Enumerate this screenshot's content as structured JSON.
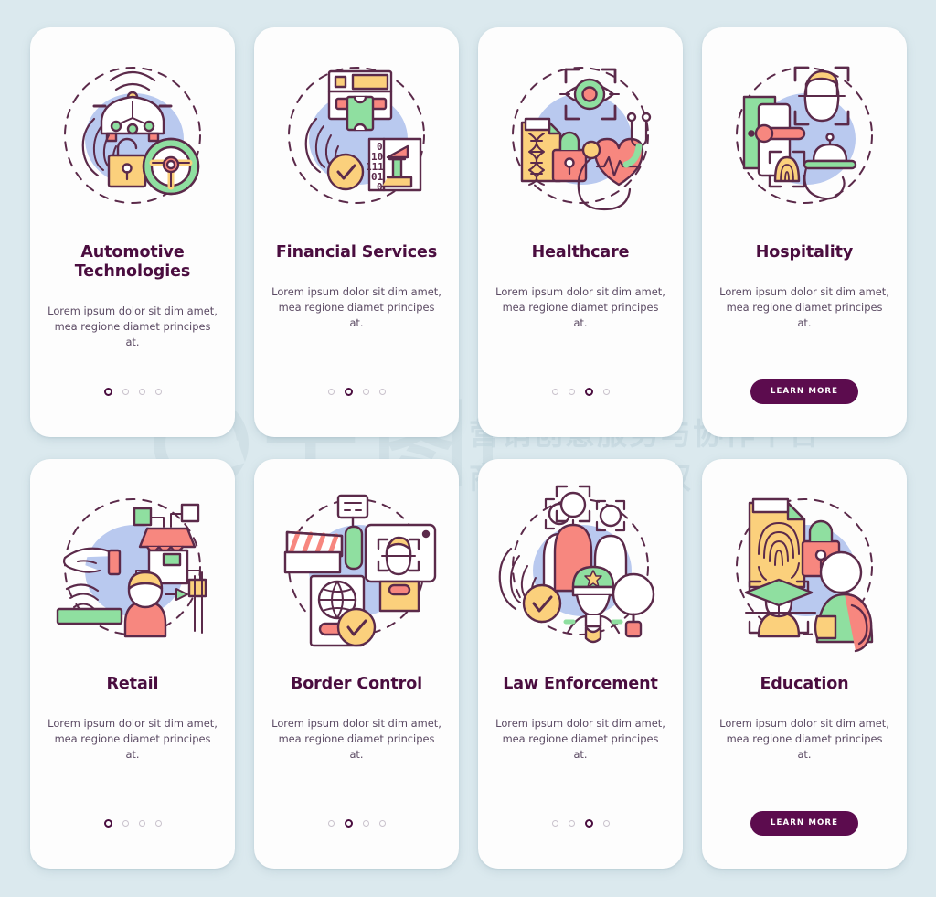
{
  "page": {
    "background_color": "#dbe9ee",
    "card_background": "#fdfdfd",
    "title_color": "#4a0d3f",
    "body_color": "#5b4a63",
    "button_color": "#5c0c4e",
    "accent_blue_blob": "#b9c9ef",
    "accent_green": "#8fdfa0",
    "accent_yellow": "#fbd07c",
    "accent_coral": "#f7877f",
    "stroke_color": "#5b2a4a"
  },
  "watermark": {
    "brand_qian": "千",
    "brand_tu": "图",
    "line1": "营销创意服务与协作平台",
    "line2": "商用请获取授权"
  },
  "common": {
    "description": "Lorem ipsum dolor sit dim amet, mea regione diamet principes at.",
    "learn_more_label": "LEARN MORE",
    "dot_count": 4
  },
  "cards": [
    {
      "title": "Automotive Technologies",
      "description": "Lorem ipsum dolor sit dim amet, mea regione diamet principes at.",
      "footer_type": "dots",
      "active_dot": 0,
      "illustration": "automotive-car-fingerprint-steeringwheel-lock-illustration"
    },
    {
      "title": "Financial Services",
      "description": "Lorem ipsum dolor sit dim amet, mea regione diamet principes at.",
      "footer_type": "dots",
      "active_dot": 1,
      "illustration": "financial-atm-fingerprint-binary-bank-illustration"
    },
    {
      "title": "Healthcare",
      "description": "Lorem ipsum dolor sit dim amet, mea regione diamet principes at.",
      "footer_type": "dots",
      "active_dot": 2,
      "illustration": "healthcare-eye-scan-dna-lock-heart-stethoscope-illustration"
    },
    {
      "title": "Hospitality",
      "description": "Lorem ipsum dolor sit dim amet, mea regione diamet principes at.",
      "footer_type": "button",
      "button_label": "LEARN MORE",
      "illustration": "hospitality-face-scan-door-handle-fingerprint-tray-illustration"
    },
    {
      "title": "Retail",
      "description": "Lorem ipsum dolor sit dim amet, mea regione diamet principes at.",
      "footer_type": "dots",
      "active_dot": 0,
      "illustration": "retail-hand-contactless-shop-customer-illustration"
    },
    {
      "title": "Border Control",
      "description": "Lorem ipsum dolor sit dim amet, mea regione diamet principes at.",
      "footer_type": "dots",
      "active_dot": 1,
      "illustration": "border-control-barrier-passport-face-scan-illustration"
    },
    {
      "title": "Law Enforcement",
      "description": "Lorem ipsum dolor sit dim amet, mea regione diamet principes at.",
      "footer_type": "dots",
      "active_dot": 2,
      "illustration": "law-enforcement-people-scan-fingerprint-police-cap-illustration"
    },
    {
      "title": "Education",
      "description": "Lorem ipsum dolor sit dim amet, mea regione diamet principes at.",
      "footer_type": "button",
      "button_label": "LEARN MORE",
      "illustration": "education-fingerprint-file-lock-student-graduate-illustration"
    }
  ]
}
